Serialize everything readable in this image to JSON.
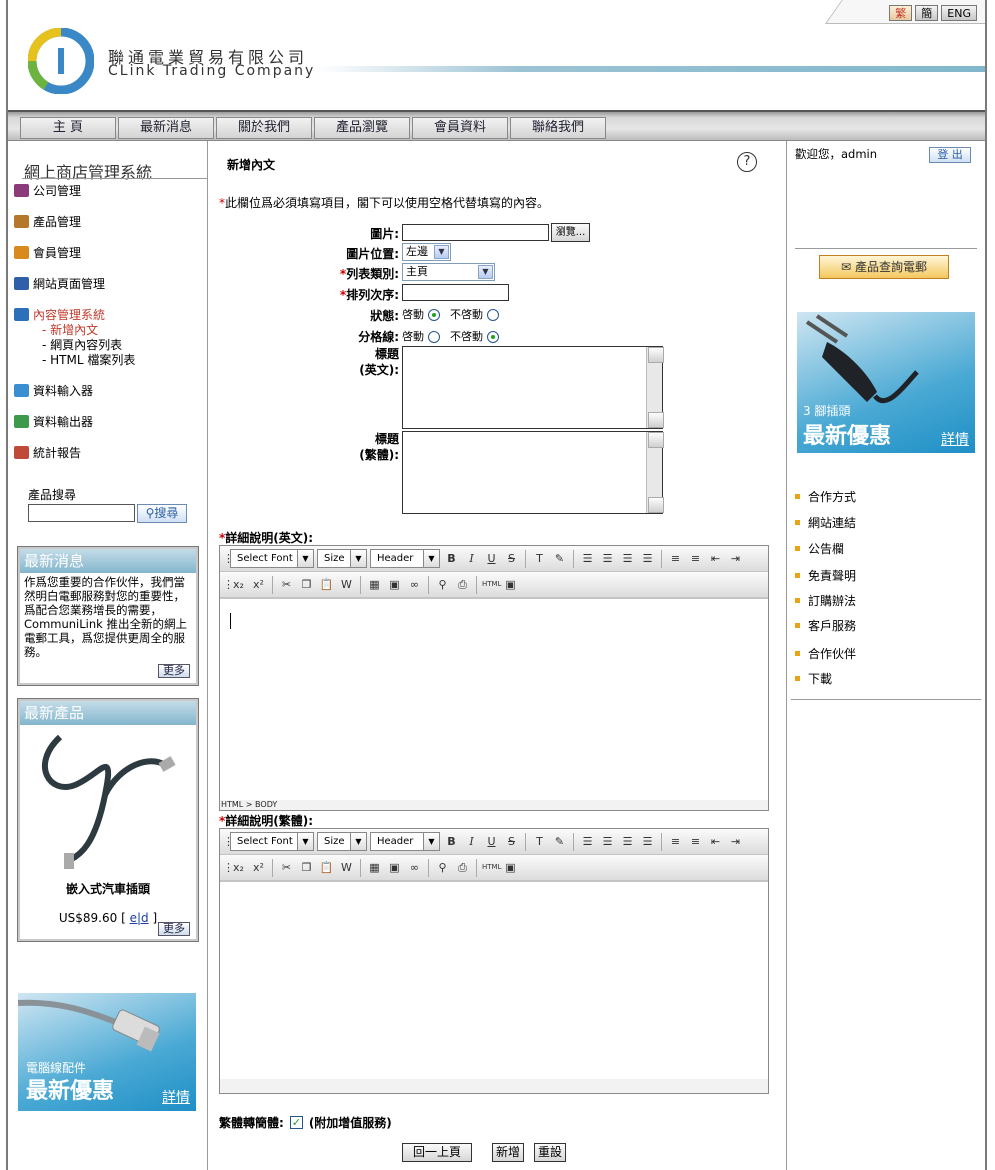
{
  "header": {
    "company_zh": "聯通電業貿易有限公司",
    "company_en": "CLink Trading Company",
    "lang": [
      "繁",
      "簡",
      "ENG"
    ]
  },
  "nav": [
    "主 頁",
    "最新消息",
    "關於我們",
    "產品瀏覽",
    "會員資料",
    "聯絡我們"
  ],
  "sidebar": {
    "title": "網上商店管理系統",
    "items": [
      {
        "label": "公司管理",
        "icon": "company-icon",
        "color": "#8b3a7a"
      },
      {
        "label": "產品管理",
        "icon": "product-icon",
        "color": "#b5772c"
      },
      {
        "label": "會員管理",
        "icon": "member-icon",
        "color": "#d98a1c"
      },
      {
        "label": "網站頁面管理",
        "icon": "webpage-icon",
        "color": "#2f5fa8"
      },
      {
        "label": "內容管理系統",
        "icon": "content-icon",
        "color": "#2d6fb8"
      },
      {
        "label": "資料輸入器",
        "icon": "import-icon",
        "color": "#3b8fd0"
      },
      {
        "label": "資料輸出器",
        "icon": "export-icon",
        "color": "#3c9a4a"
      },
      {
        "label": "統計報告",
        "icon": "report-icon",
        "color": "#c04a3a"
      }
    ],
    "subitems": [
      "- 新增內文",
      "- 網頁內容列表",
      "- HTML 檔案列表"
    ],
    "search_label": "產品搜尋",
    "search_button": "搜尋",
    "news_title": "最新消息",
    "news_text": "作爲您重要的合作伙伴，我們當然明白電郵服務對您的重要性，爲配合您業務增長的需要，CommuniLink 推出全新的網上電郵工具，爲您提供更周全的服務。",
    "more": "更多",
    "products_title": "最新產品",
    "product_name": "嵌入式汽車插頭",
    "product_price": "US$89.60 [",
    "product_links": "e|d",
    "product_close": "]",
    "promo_small": "電腦線配件",
    "promo_big": "最新優惠",
    "promo_detail": "詳情"
  },
  "form": {
    "title": "新增內文",
    "help": "?",
    "note_star": "*",
    "note": "此欄位爲必須填寫項目，閣下可以使用空格代替填寫的內容。",
    "image_label": "圖片:",
    "browse": "瀏覽...",
    "image_pos_label": "圖片位置:",
    "image_pos_value": "左邊",
    "list_type_label": "列表類別:",
    "list_type_value": "主頁",
    "order_label": "排列次序:",
    "status_label": "狀態:",
    "divider_label": "分格線:",
    "enable": "啓動",
    "disable": "不啓動",
    "title_en_label1": "標題",
    "title_en_label2": "(英文):",
    "title_zh_label1": "標題",
    "title_zh_label2": "(繁體):",
    "detail_en_label": "詳細說明(英文):",
    "detail_zh_label": "詳細說明(繁體):",
    "font_select": "Select Font",
    "size_select": "Size",
    "header_select": "Header",
    "statusbar": "HTML > BODY",
    "convert_label": "繁體轉簡體:",
    "convert_note": "(附加增值服務)",
    "back_button": "回一上頁",
    "add_button": "新增",
    "reset_button": "重設"
  },
  "right": {
    "welcome": "歡迎您，admin",
    "logout": "登 出",
    "enquiry": "產品查詢電郵",
    "promo_small": "3 腳插頭",
    "promo_big": "最新優惠",
    "promo_detail": "詳情",
    "links": [
      "合作方式",
      "網站連結",
      "公告欄",
      "免責聲明",
      "訂購辦法",
      "客戶服務",
      "合作伙伴",
      "下載"
    ]
  }
}
